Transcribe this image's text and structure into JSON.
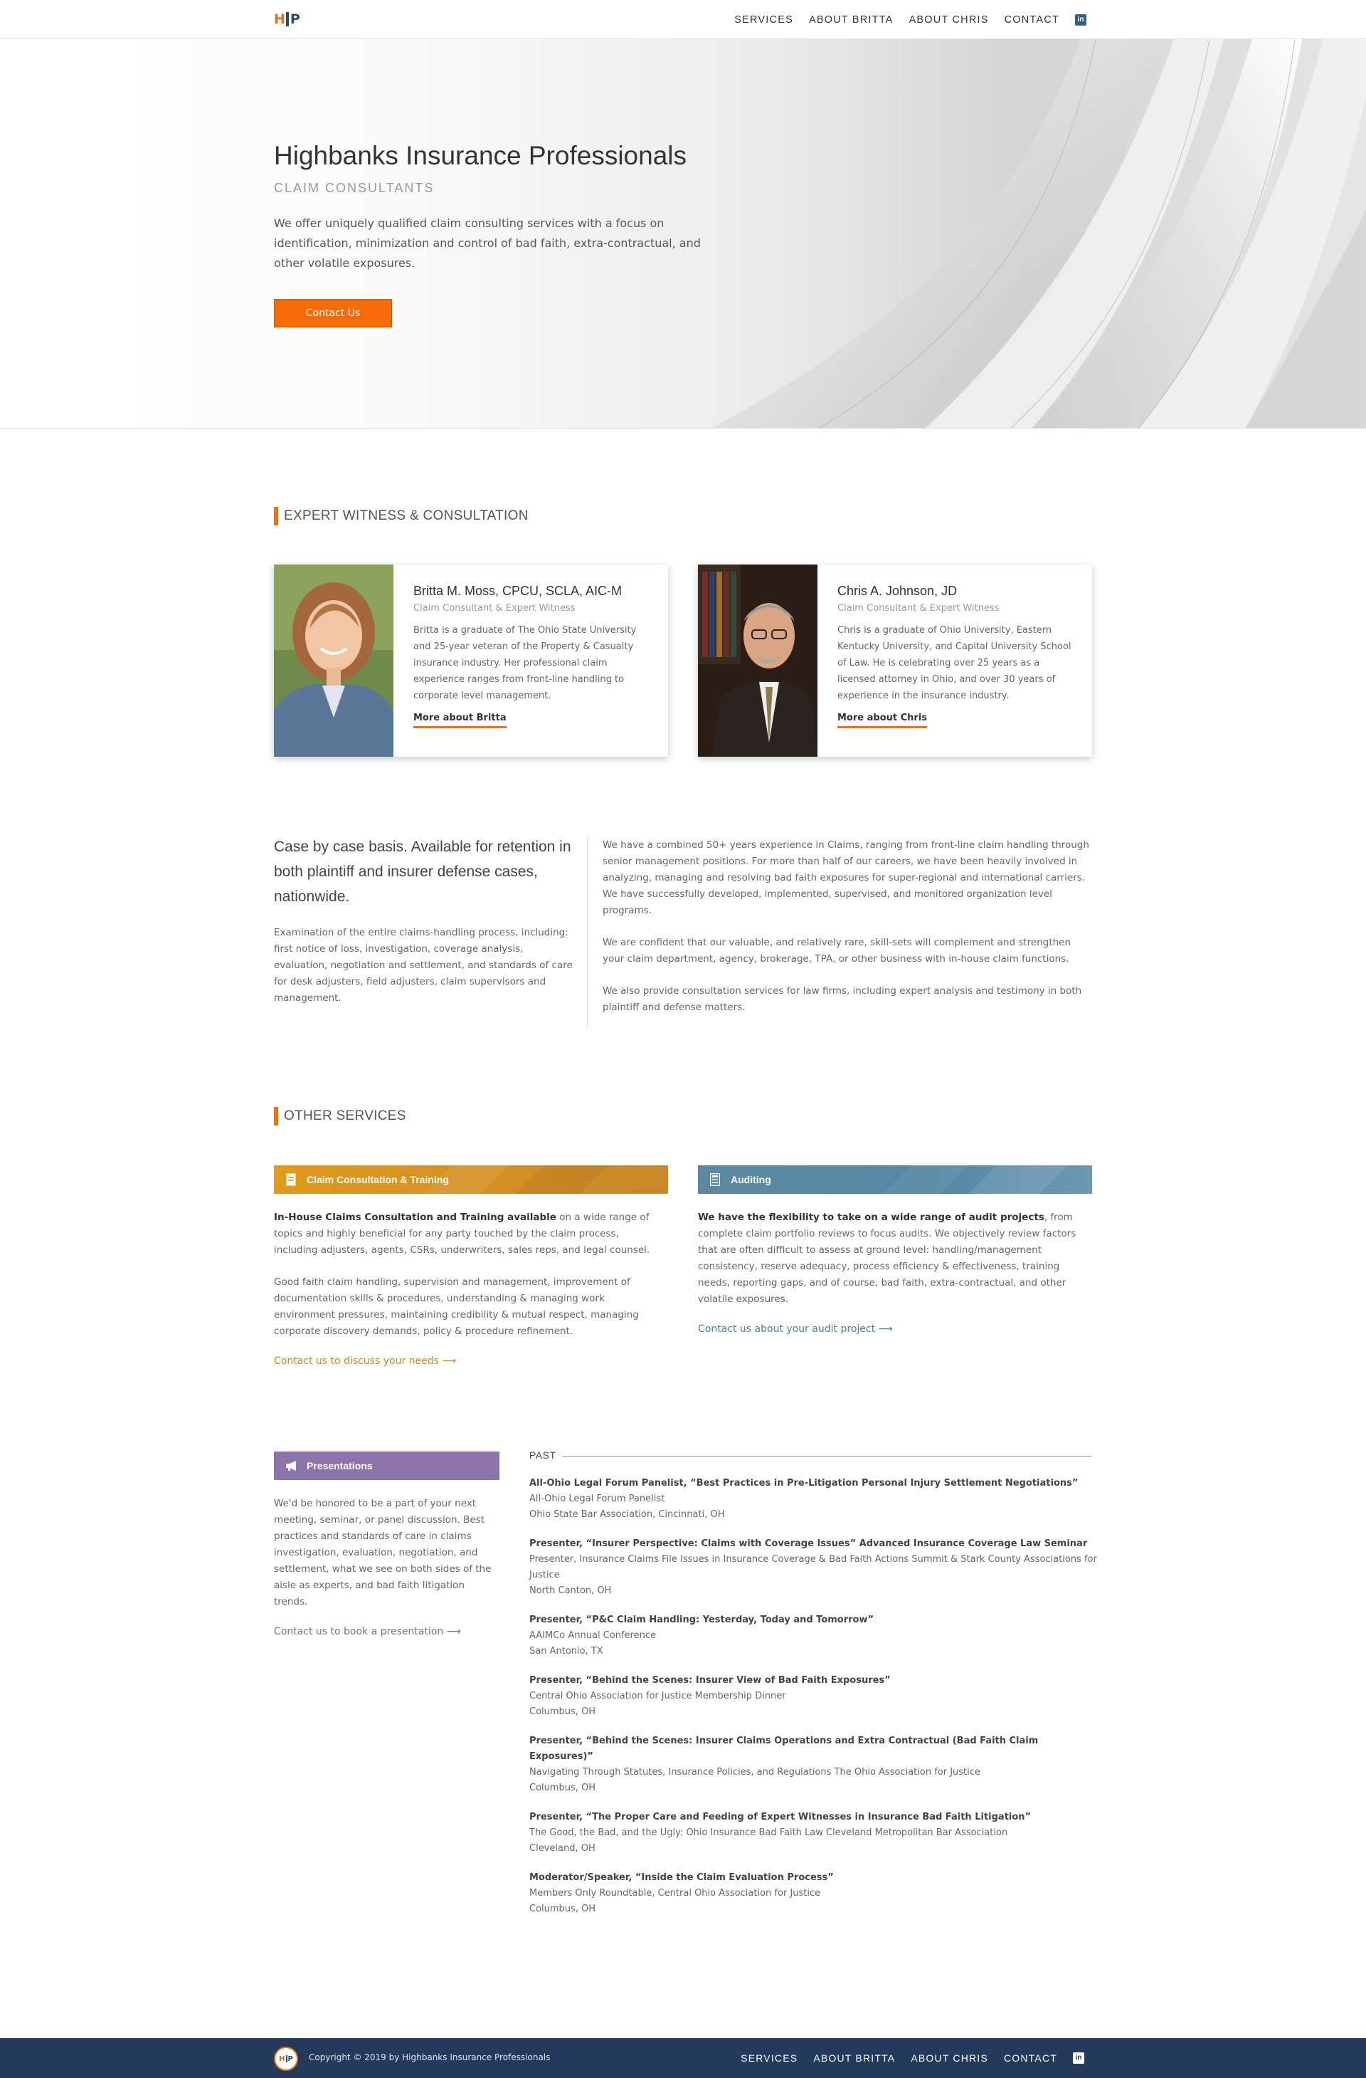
{
  "nav": {
    "logo": {
      "h": "H",
      "p": "P"
    },
    "links": [
      "SERVICES",
      "ABOUT BRITTA",
      "ABOUT CHRIS",
      "CONTACT"
    ],
    "linkedin_icon": "in"
  },
  "hero": {
    "title": "Highbanks Insurance Professionals",
    "subtitle": "CLAIM CONSULTANTS",
    "description": "We offer uniquely qualified claim consulting services with a focus on identification, minimization and control of bad faith, extra-contractual, and other volatile exposures.",
    "button": "Contact Us"
  },
  "expert": {
    "heading": "EXPERT WITNESS & CONSULTATION",
    "people": [
      {
        "name": "Britta M. Moss, CPCU, SCLA, AIC-M",
        "role": "Claim Consultant & Expert Witness",
        "bio": "Britta is a graduate of The Ohio State University and 25-year veteran of the Property & Casualty insurance industry. Her professional claim experience ranges from front-line handling to corporate level management.",
        "link": "More about Britta"
      },
      {
        "name": "Chris A. Johnson, JD",
        "role": "Claim Consultant & Expert Witness",
        "bio": "Chris is a graduate of Ohio University, Eastern Kentucky University, and Capital University School of Law. He is celebrating over 25 years as a licensed attorney in Ohio, and over 30 years of experience in the insurance industry.",
        "link": "More about Chris"
      }
    ]
  },
  "case": {
    "quote": "Case by case basis. Available for retention in both plaintiff and insurer defense cases, nationwide.",
    "detail": "Examination of the entire claims-handling process, including: first notice of loss, investigation, coverage analysis, evaluation, negotiation and settlement, and standards of care for desk adjusters, field adjusters, claim supervisors and management.",
    "paragraphs": [
      "We have a combined 50+ years experience in Claims, ranging from front-line claim handling through senior management positions. For more than half of our careers, we have been heavily involved in analyzing, managing and resolving bad faith exposures for super-regional and international carriers. We have successfully developed, implemented, supervised, and monitored organization level programs.",
      "We are confident that our valuable, and relatively rare, skill-sets will complement and strengthen your claim department, agency, brokerage, TPA, or other business with in-house claim functions.",
      "We also provide consultation services for law firms, including expert analysis and testimony in both plaintiff and defense matters."
    ]
  },
  "other": {
    "heading": "OTHER SERVICES",
    "training": {
      "banner": "Claim Consultation & Training",
      "lead_bold": "In-House Claims Consultation and Training available",
      "lead_rest": " on a wide range of topics and highly beneficial for any party touched by the claim process, including adjusters, agents, CSRs, underwriters, sales reps, and legal counsel.",
      "body": "Good faith claim handling, supervision and management, improvement of documentation skills & procedures, understanding & managing work environment pressures, maintaining credibility & mutual respect, managing corporate discovery demands, policy & procedure refinement.",
      "link": "Contact us to discuss your needs ⟶"
    },
    "auditing": {
      "banner": "Auditing",
      "lead_bold": "We have the flexibility to take on a wide range of audit projects",
      "lead_rest": ", from complete claim portfolio reviews to focus audits.  We objectively review factors that are often difficult to assess at ground level: handling/management consistency, reserve adequacy, process efficiency & effectiveness, training needs, reporting gaps, and of course, bad faith, extra-contractual, and other volatile exposures.",
      "link": "Contact us about your audit project ⟶"
    }
  },
  "presentations": {
    "banner": "Presentations",
    "text": "We'd be honored to be a part of your next meeting, seminar, or panel discussion. Best practices and standards of care in claims investigation, evaluation, negotiation, and settlement, what we see on both sides of the aisle as experts, and bad faith litigation trends.",
    "link": "Contact us to book a presentation ⟶",
    "past_label": "PAST",
    "items": [
      {
        "title": "All-Ohio Legal Forum Panelist, “Best Practices in Pre-Litigation Personal Injury Settlement Negotiations”",
        "lines": [
          "All-Ohio Legal Forum Panelist",
          "Ohio State Bar Association, Cincinnati, OH"
        ]
      },
      {
        "title": "Presenter, “Insurer Perspective: Claims with Coverage Issues” Advanced Insurance Coverage Law Seminar",
        "lines": [
          "Presenter, Insurance Claims File Issues in Insurance Coverage & Bad Faith Actions Summit & Stark County Associations for Justice",
          "North Canton, OH"
        ]
      },
      {
        "title": "Presenter, “P&C Claim Handling: Yesterday, Today and Tomorrow”",
        "lines": [
          "AAIMCo Annual Conference",
          "San Antonio, TX"
        ]
      },
      {
        "title": "Presenter, “Behind the Scenes: Insurer View of Bad Faith Exposures”",
        "lines": [
          "Central Ohio Association for Justice Membership Dinner",
          "Columbus, OH"
        ]
      },
      {
        "title": "Presenter, “Behind the Scenes: Insurer Claims Operations and Extra Contractual (Bad Faith Claim Exposures)”",
        "lines": [
          "Navigating Through Statutes, Insurance Policies, and Regulations The Ohio Association for Justice",
          "Columbus, OH"
        ]
      },
      {
        "title": "Presenter, “The Proper Care and Feeding of Expert Witnesses in Insurance Bad Faith Litigation”",
        "lines": [
          "The Good, the Bad, and the Ugly: Ohio Insurance Bad Faith Law Cleveland Metropolitan Bar Association",
          "Cleveland, OH"
        ]
      },
      {
        "title": "Moderator/Speaker, “Inside the Claim Evaluation Process”",
        "lines": [
          "Members Only Roundtable, Central Ohio Association for Justice",
          "Columbus, OH"
        ]
      }
    ]
  },
  "footer": {
    "copyright": "Copyright © 2019 by Highbanks Insurance Professionals",
    "links": [
      "SERVICES",
      "ABOUT BRITTA",
      "ABOUT CHRIS",
      "CONTACT"
    ],
    "linkedin_icon": "in"
  },
  "colors": {
    "accent_orange": "#f07014",
    "training_gold": "#d4941e",
    "auditing_blue": "#5a8aa3",
    "presentations_purple": "#8c74aa",
    "footer_navy": "#233a5c"
  }
}
